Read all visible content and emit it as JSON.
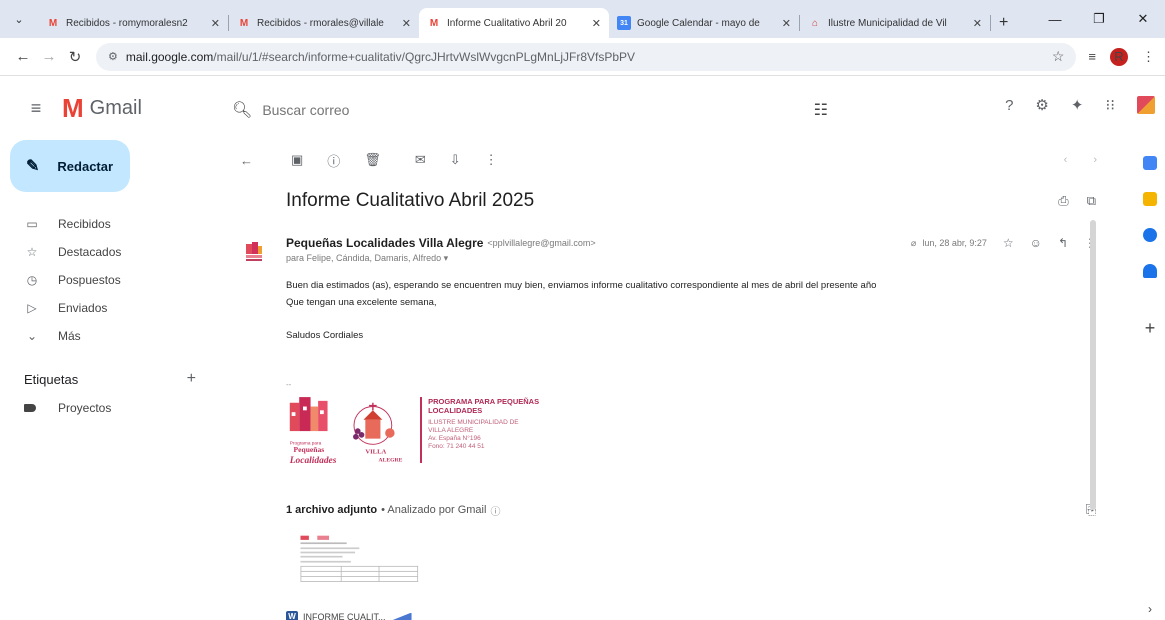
{
  "browser": {
    "tabs": [
      {
        "title": "Recibidos - romymoralesn2",
        "favicon": "gmail-icon",
        "active": false
      },
      {
        "title": "Recibidos - rmorales@villale",
        "favicon": "gmail-icon",
        "active": false
      },
      {
        "title": "Informe Cualitativo Abril 20",
        "favicon": "gmail-icon",
        "active": true
      },
      {
        "title": "Google Calendar - mayo de",
        "favicon": "calendar-icon",
        "active": false
      },
      {
        "title": "Ilustre Municipalidad de Vil",
        "favicon": "municipal-icon",
        "active": false
      }
    ],
    "url_host": "mail.google.com",
    "url_path": "/mail/u/1/#search/informe+cualitativ/QgrcJHrtvWslWvgcnPLgMnLjJFr8VfsPbPV",
    "profile_initial": "R"
  },
  "gmail": {
    "app_name": "Gmail",
    "search_placeholder": "Buscar correo",
    "compose_label": "Redactar",
    "nav": [
      {
        "label": "Recibidos",
        "icon": "inbox-icon"
      },
      {
        "label": "Destacados",
        "icon": "star-icon"
      },
      {
        "label": "Pospuestos",
        "icon": "clock-icon"
      },
      {
        "label": "Enviados",
        "icon": "send-icon"
      },
      {
        "label": "Más",
        "icon": "chevron-down-icon"
      }
    ],
    "labels_title": "Etiquetas",
    "labels": [
      {
        "label": "Proyectos"
      }
    ]
  },
  "email": {
    "subject": "Informe Cualitativo Abril 2025",
    "sender_name": "Pequeñas Localidades Villa Alegre",
    "sender_email": "<pplvillalegre@gmail.com>",
    "recipients": "para Felipe, Cándida, Damaris, Alfredo",
    "date": "lun, 28 abr, 9:27",
    "body": [
      "Buen dia estimados (as), esperando se encuentren muy bien, enviamos informe cualitativo correspondiente al mes de abril del presente año",
      "Que tengan una excelente semana,",
      "Saludos Cordiales"
    ],
    "signature_dash": "--",
    "signature": {
      "program_title": "PROGRAMA PARA PEQUEÑAS LOCALIDADES",
      "lines": [
        "ILUSTRE MUNICIPALIDAD DE",
        "VILLA ALEGRE",
        "Av. España N°196",
        "Fono: 71 240 44 51"
      ],
      "logo_text_a": "Pequeñas",
      "logo_text_b": "Localidades",
      "logo_text_c": "VILLA",
      "logo_text_d": "ALEGRE"
    },
    "attachments_count": "1 archivo adjunto",
    "attachments_scanned": "Analizado por Gmail",
    "attachment_name": "INFORME CUALIT...",
    "attachment_type": "W"
  },
  "colors": {
    "compose_bg": "#c2e7ff",
    "brand_pink": "#b02a55",
    "gmail_red": "#ea4335"
  }
}
